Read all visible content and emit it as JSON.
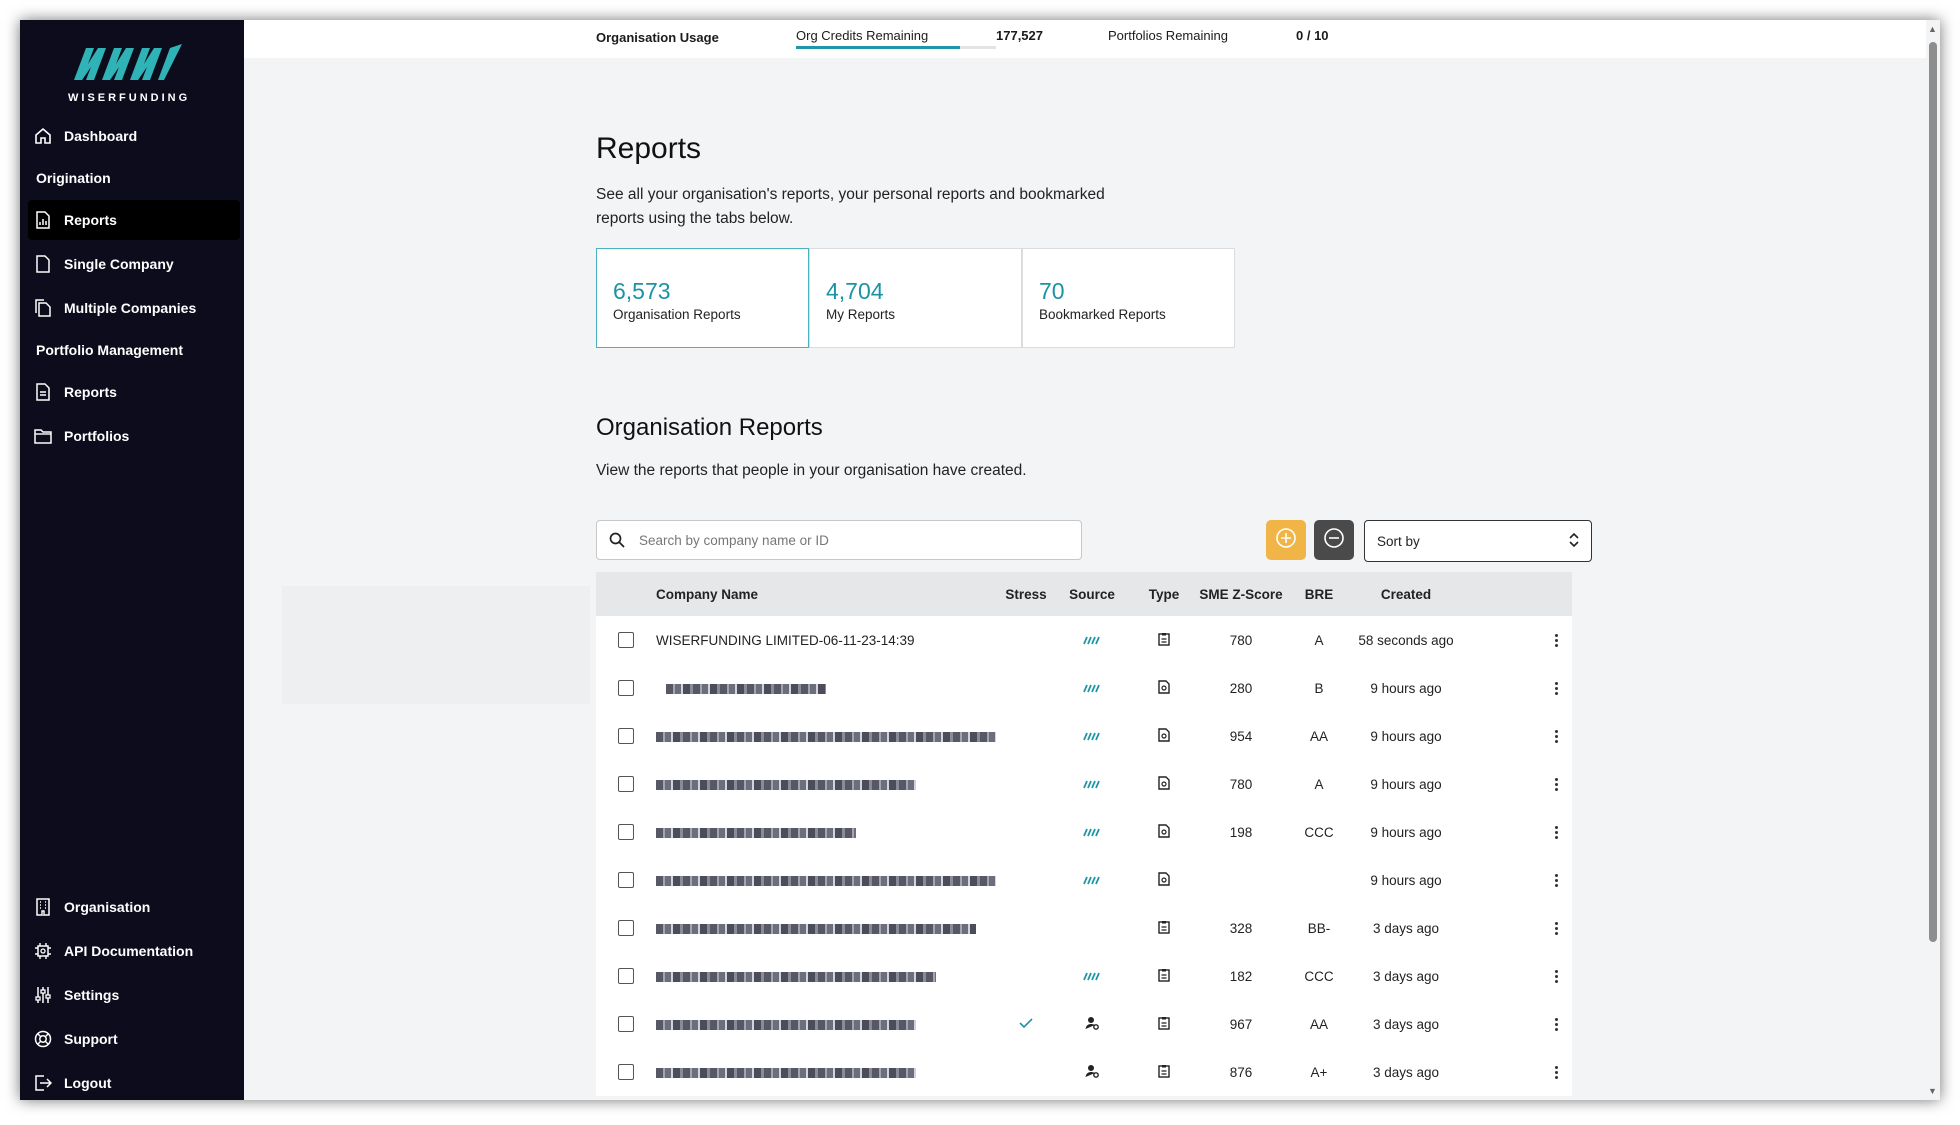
{
  "brand": {
    "name": "WISERFUNDING"
  },
  "sidebar": {
    "dashboard": "Dashboard",
    "origination_heading": "Origination",
    "reports": "Reports",
    "single_company": "Single Company",
    "multiple_companies": "Multiple Companies",
    "portfolio_heading": "Portfolio Management",
    "portfolio_reports": "Reports",
    "portfolios": "Portfolios",
    "organisation": "Organisation",
    "api_docs": "API Documentation",
    "settings": "Settings",
    "support": "Support",
    "logout": "Logout"
  },
  "usage": {
    "label": "Organisation Usage",
    "credits_label": "Org Credits Remaining",
    "credits_value": "177,527",
    "credits_fraction": 0.82,
    "portfolios_label": "Portfolios Remaining",
    "portfolios_value": "0 / 10"
  },
  "page": {
    "title": "Reports",
    "description": "See all your organisation's reports, your personal reports and bookmarked reports using the tabs below."
  },
  "stats": [
    {
      "value": "6,573",
      "label": "Organisation Reports"
    },
    {
      "value": "4,704",
      "label": "My Reports"
    },
    {
      "value": "70",
      "label": "Bookmarked Reports"
    }
  ],
  "section": {
    "title": "Organisation Reports",
    "description": "View the reports that people in your organisation have created."
  },
  "search": {
    "placeholder": "Search by company name or ID"
  },
  "sort": {
    "label": "Sort by"
  },
  "table": {
    "headers": {
      "company": "Company Name",
      "stress": "Stress",
      "source": "Source",
      "type": "Type",
      "zscore": "SME Z-Score",
      "bre": "BRE",
      "created": "Created"
    },
    "rows": [
      {
        "name": "WISERFUNDING LIMITED-06-11-23-14:39",
        "stress": "",
        "source": "wiserfunding-icon",
        "type": "clipboard-icon",
        "zscore": "780",
        "bre": "A",
        "created": "58 seconds ago"
      },
      {
        "name": "",
        "stress": "",
        "source": "wiserfunding-icon",
        "type": "document-search-icon",
        "zscore": "280",
        "bre": "B",
        "created": "9 hours ago"
      },
      {
        "name": "",
        "stress": "",
        "source": "wiserfunding-icon",
        "type": "document-search-icon",
        "zscore": "954",
        "bre": "AA",
        "created": "9 hours ago"
      },
      {
        "name": "",
        "stress": "",
        "source": "wiserfunding-icon",
        "type": "document-search-icon",
        "zscore": "780",
        "bre": "A",
        "created": "9 hours ago"
      },
      {
        "name": "",
        "stress": "",
        "source": "wiserfunding-icon",
        "type": "document-search-icon",
        "zscore": "198",
        "bre": "CCC",
        "created": "9 hours ago"
      },
      {
        "name": "",
        "stress": "",
        "source": "wiserfunding-icon",
        "type": "document-search-icon",
        "zscore": "",
        "bre": "",
        "created": "9 hours ago"
      },
      {
        "name": "",
        "stress": "",
        "source": "",
        "type": "clipboard-icon",
        "zscore": "328",
        "bre": "BB-",
        "created": "3 days ago"
      },
      {
        "name": "",
        "stress": "",
        "source": "wiserfunding-icon",
        "type": "clipboard-icon",
        "zscore": "182",
        "bre": "CCC",
        "created": "3 days ago"
      },
      {
        "name": "",
        "stress": "check-icon",
        "source": "user-settings-icon",
        "type": "clipboard-icon",
        "zscore": "967",
        "bre": "AA",
        "created": "3 days ago"
      },
      {
        "name": "",
        "stress": "",
        "source": "user-settings-icon",
        "type": "clipboard-icon",
        "zscore": "876",
        "bre": "A+",
        "created": "3 days ago"
      }
    ]
  },
  "colors": {
    "accent": "#1f97a8",
    "sidebar": "#0d0c1d",
    "add_button": "#f1b447"
  }
}
